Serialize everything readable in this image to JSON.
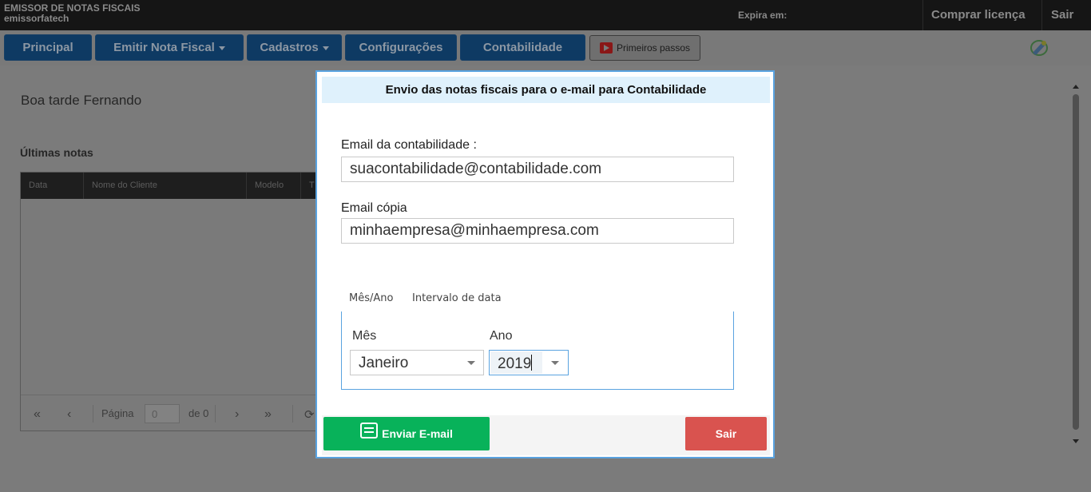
{
  "topbar": {
    "title": "EMISSOR DE NOTAS FISCAIS",
    "subtitle": "emissorfatech",
    "expira_label": "Expira em:",
    "buy_license": "Comprar licença",
    "logout": "Sair"
  },
  "nav": {
    "items": [
      {
        "label": "Principal"
      },
      {
        "label": "Emitir Nota Fiscal"
      },
      {
        "label": "Cadastros"
      },
      {
        "label": "Configurações"
      },
      {
        "label": "Contabilidade"
      }
    ],
    "first_steps": "Primeiros passos"
  },
  "main": {
    "greeting": "Boa tarde Fernando",
    "latest_notes_title": "Últimas notas",
    "table_headers": [
      "Data",
      "Nome do Cliente",
      "Modelo",
      "T"
    ],
    "pager": {
      "page_label": "Página",
      "page_value": "0",
      "of_label": "de 0"
    }
  },
  "modal": {
    "title": "Envio das notas fiscais para o e-mail para Contabilidade",
    "email_label": "Email da contabilidade :",
    "email_value": "suacontabilidade@contabilidade.com",
    "copy_label": "Email cópia",
    "copy_value": "minhaempresa@minhaempresa.com",
    "tabs": [
      "Mês/Ano",
      "Intervalo de data"
    ],
    "month_label": "Mês",
    "month_value": "Janeiro",
    "year_label": "Ano",
    "year_value": "2019",
    "send_button": "Enviar E-mail",
    "exit_button": "Sair"
  },
  "colors": {
    "nav_blue": "#0e3a63",
    "send_green": "#08b25a",
    "exit_red": "#d9534f",
    "modal_header_bg": "#dff1fc",
    "modal_border": "#5aa3e0"
  }
}
